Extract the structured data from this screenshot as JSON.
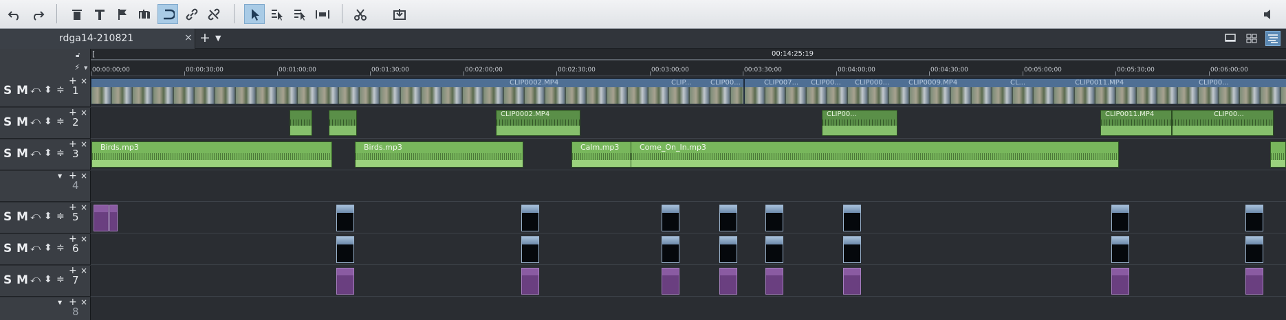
{
  "toolbar": {
    "buttons": [
      {
        "name": "undo-button",
        "icon": "undo-icon"
      },
      {
        "name": "redo-button",
        "icon": "redo-icon"
      },
      {
        "name": "delete-button",
        "icon": "trash-icon"
      },
      {
        "name": "title-button",
        "icon": "text-icon"
      },
      {
        "name": "marker-button",
        "icon": "flag-icon"
      },
      {
        "name": "split-button",
        "icon": "scissors-split-icon"
      },
      {
        "name": "ripple-button",
        "icon": "ripple-icon"
      },
      {
        "name": "group-button",
        "icon": "link-icon"
      },
      {
        "name": "ungroup-button",
        "icon": "unlink-icon"
      },
      {
        "name": "pointer-mode-button",
        "icon": "pointer-icon"
      },
      {
        "name": "tool-a-button",
        "icon": "edit-mode-icon"
      },
      {
        "name": "tool-b-button",
        "icon": "edit-mode-icon"
      },
      {
        "name": "tool-c-button",
        "icon": "stretch-icon"
      },
      {
        "name": "cut-button",
        "icon": "cut-icon"
      },
      {
        "name": "insert-button",
        "icon": "insert-icon"
      },
      {
        "name": "volume-button",
        "icon": "speaker-icon"
      }
    ],
    "accent": "#a9cbe6"
  },
  "tabs": {
    "project_name": "rdga14-210821",
    "close_glyph": "×",
    "add_glyph": "+",
    "dropdown_glyph": "▼"
  },
  "ruler": {
    "position_time": "00:14:25:19",
    "ticks": [
      "00:00:00;00",
      "00:00:30;00",
      "00:01:00;00",
      "00:01:30;00",
      "00:02:00;00",
      "00:02:30;00",
      "00:03:00;00",
      "00:03:30;00",
      "00:04:00;00",
      "00:04:30;00",
      "00:05:00;00",
      "00:05:30;00",
      "00:06:00;00"
    ]
  },
  "track_controls": {
    "solo": "S",
    "mute": "M",
    "plus": "+",
    "close": "×"
  },
  "tracks": [
    {
      "number": "1"
    },
    {
      "number": "2"
    },
    {
      "number": "3"
    },
    {
      "number": "4"
    },
    {
      "number": "5"
    },
    {
      "number": "6"
    },
    {
      "number": "7"
    },
    {
      "number": "8"
    }
  ],
  "clips": {
    "track1_labels": [
      "CLIP0002.MP4",
      "CLIP...",
      "CLIP00...",
      "CLIP007...",
      "CLIP00...",
      "CLIP000...",
      "CLIP0009.MP4",
      "CL...",
      "CLIP0011.MP4",
      "CLIP00..."
    ],
    "track2_labels": [
      "CLIP0002.MP4",
      "CLIP00...",
      "CLIP0011.MP4",
      "CLIP00..."
    ],
    "track3_labels": [
      "Birds.mp3",
      "Birds.mp3",
      "Calm.mp3",
      "Come_On_In.mp3"
    ]
  },
  "colors": {
    "video_clip": "#4f6f94",
    "overlay_clip": "#5a8f48",
    "audio_clip": "#78b75c",
    "title_clip": "#6a3f80"
  }
}
